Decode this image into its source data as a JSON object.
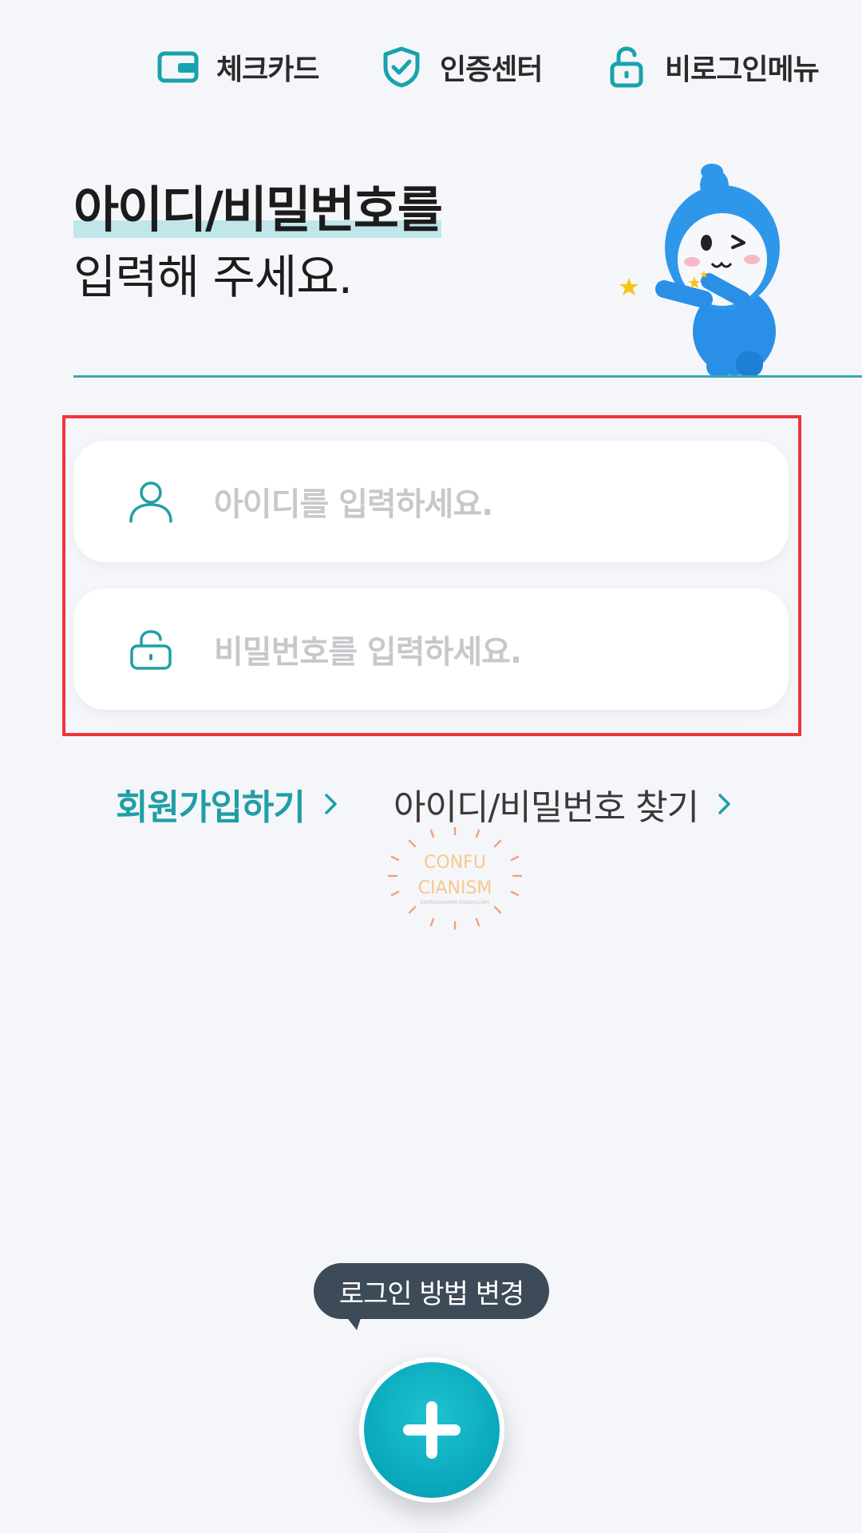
{
  "topnav": {
    "items": [
      {
        "label": "체크카드",
        "icon": "card-icon"
      },
      {
        "label": "인증센터",
        "icon": "shield-check-icon"
      },
      {
        "label": "비로그인메뉴",
        "icon": "unlock-icon"
      }
    ]
  },
  "heading": {
    "line1": "아이디/비밀번호를",
    "line2": "입력해 주세요."
  },
  "form": {
    "id_placeholder": "아이디를 입력하세요.",
    "password_placeholder": "비밀번호를 입력하세요."
  },
  "links": {
    "join": "회원가입하기",
    "find": "아이디/비밀번호 찾기"
  },
  "watermark": {
    "line1": "CONFU",
    "line2": "CIANISM",
    "line3": "confucianism.tistory.com"
  },
  "tooltip": {
    "text": "로그인 방법 변경"
  },
  "colors": {
    "accent": "#1f9fa5",
    "highlight_border": "#f0353d",
    "fab": "#0aa9bd",
    "tooltip_bg": "#3d4a57"
  }
}
